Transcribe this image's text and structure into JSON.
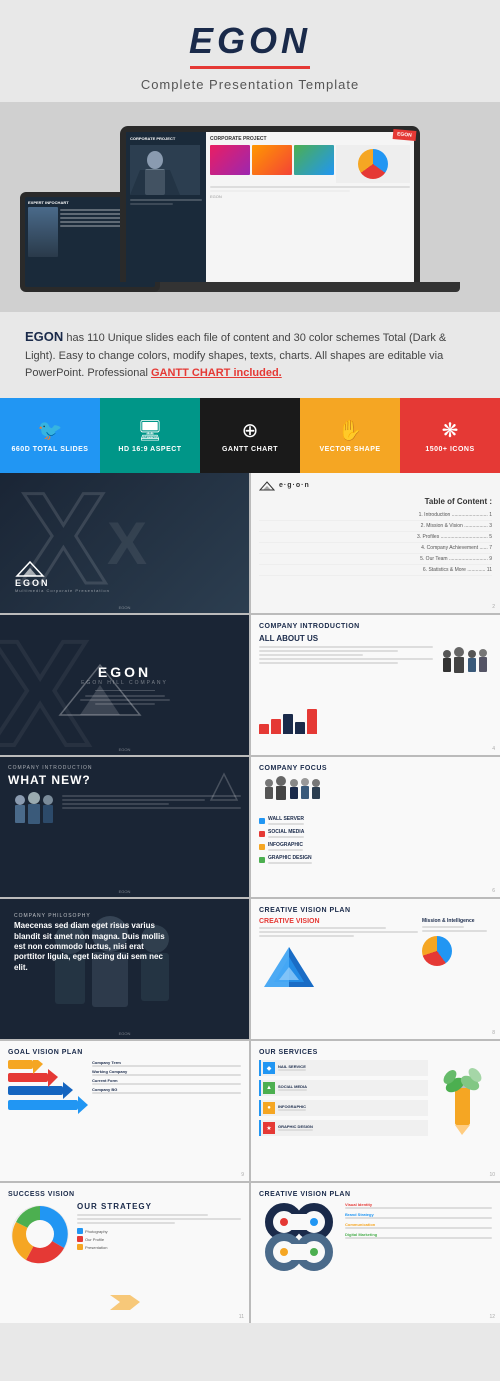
{
  "header": {
    "brand": "EGON",
    "underline_color": "#e53935",
    "subtitle": "Complete Presentation Template"
  },
  "description": {
    "brand_text": "EGON",
    "body": " has 110 Unique slides  each file of content and 30 color schemes Total (Dark & Light). Easy to change colors, modify shapes, texts, charts. All shapes are editable via PowerPoint. Professional ",
    "highlight": "GANTT CHART included.",
    "after": ""
  },
  "features": [
    {
      "id": "f1",
      "icon": "🐦",
      "label": "660D TOTAL SLIDES",
      "color": "#2196f3"
    },
    {
      "id": "f2",
      "icon": "🖥",
      "label": "HD 16:9 ASPECT",
      "color": "#009688"
    },
    {
      "id": "f3",
      "icon": "⊕",
      "label": "GANTT CHART",
      "color": "#1a1a1a"
    },
    {
      "id": "f4",
      "icon": "✋",
      "label": "VECTOR SHAPE",
      "color": "#f5a623"
    },
    {
      "id": "f5",
      "icon": "❋",
      "label": "1500+ ICONS",
      "color": "#e53935"
    }
  ],
  "slides": [
    {
      "id": "s1",
      "type": "dark-x",
      "label": "Title Dark X"
    },
    {
      "id": "s2",
      "type": "toc",
      "label": "Table of Contents"
    },
    {
      "id": "s3",
      "type": "dark-egon",
      "label": "Egon Hill Company"
    },
    {
      "id": "s4",
      "type": "company-intro",
      "label": "Company Introduction - About Us"
    },
    {
      "id": "s5",
      "type": "what-new",
      "label": "What New"
    },
    {
      "id": "s6",
      "type": "company-focus",
      "label": "Company Focus"
    },
    {
      "id": "s7",
      "type": "philosophy",
      "label": "Company Philosophy"
    },
    {
      "id": "s8",
      "type": "creative-vision",
      "label": "Creative Vision Plan"
    },
    {
      "id": "s9",
      "type": "goal-vision",
      "label": "Goal Vision Plan"
    },
    {
      "id": "s10",
      "type": "our-services",
      "label": "Our Services"
    },
    {
      "id": "s11",
      "type": "success-vision",
      "label": "Success Vision"
    },
    {
      "id": "s12",
      "type": "creative-vision2",
      "label": "Creative Vision Plan 2"
    }
  ],
  "toc": {
    "title": "Table of Content :",
    "items": [
      "Introduction",
      "Mission & Vision",
      "Profiles",
      "Company Achievement",
      "Our Team",
      "Statistics & More"
    ]
  },
  "focus_items": [
    {
      "icon": "📡",
      "label": "WALL SERVER"
    },
    {
      "icon": "📱",
      "label": "SOCIAL MEDIA"
    },
    {
      "icon": "📊",
      "label": "INFOGRAPHIC"
    },
    {
      "icon": "🎨",
      "label": "GRAPHIC DESIGN"
    }
  ],
  "service_items": [
    {
      "label": "NAIL SERVICE",
      "color": "#2196f3"
    },
    {
      "label": "SOCIAL MEDIA",
      "color": "#4caf50"
    },
    {
      "label": "INFOGRAPHIC",
      "color": "#e53935"
    },
    {
      "label": "GRAPHIC DESIGN",
      "color": "#f5a623"
    }
  ]
}
